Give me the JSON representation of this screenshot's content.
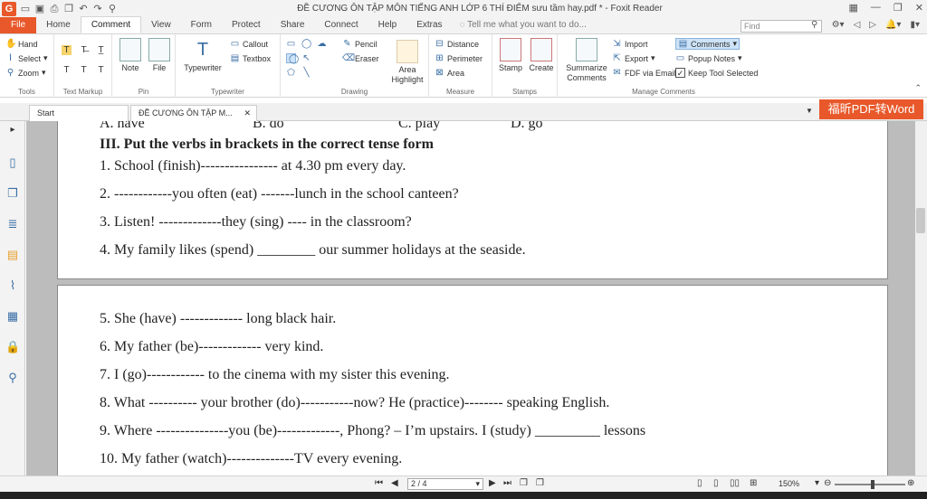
{
  "app": {
    "title": "ĐỀ CƯƠNG ÔN TẬP MÔN TIẾNG ANH LỚP 6 THÍ ĐIỂM sưu tầm hay.pdf * - Foxit Reader",
    "brand_color": "#e8582a"
  },
  "menu_tabs": [
    "File",
    "Home",
    "Comment",
    "View",
    "Form",
    "Protect",
    "Share",
    "Connect",
    "Help",
    "Extras"
  ],
  "tell_me": "Tell me what you want to do...",
  "find_placeholder": "Find",
  "ribbon": {
    "tools": {
      "items": [
        "Hand",
        "Select",
        "Zoom"
      ],
      "label": "Tools"
    },
    "text_markup": {
      "label": "Text Markup"
    },
    "pin": {
      "note": "Note",
      "file": "File",
      "label": "Pin"
    },
    "typewriter": {
      "typewriter": "Typewriter",
      "callout": "Callout",
      "textbox": "Textbox",
      "label": "Typewriter"
    },
    "drawing": {
      "pencil": "Pencil",
      "eraser": "Eraser",
      "area_highlight": "Area Highlight",
      "label": "Drawing"
    },
    "measure": {
      "distance": "Distance",
      "perimeter": "Perimeter",
      "area": "Area",
      "label": "Measure"
    },
    "stamps": {
      "stamp": "Stamp",
      "create": "Create",
      "label": "Stamps"
    },
    "manage": {
      "summarize": "Summarize Comments",
      "import": "Import",
      "export": "Export",
      "fdf": "FDF via Email",
      "comments": "Comments",
      "popup": "Popup Notes",
      "keep": "Keep Tool Selected",
      "label": "Manage Comments"
    }
  },
  "doc_tabs": [
    "Start",
    "ĐỀ CƯƠNG ÔN TẬP M..."
  ],
  "brand_banner": "福昕PDF转Word",
  "page1": {
    "options": {
      "a": "A. have",
      "b": "B. do",
      "c": "C. play",
      "d": "D. go"
    },
    "heading": "III. Put the verbs in brackets in the correct tense form",
    "lines": [
      "1. School (finish)---------------- at 4.30 pm every day.",
      "2. ------------you often (eat) -------lunch in the school canteen?",
      "3. Listen! -------------they (sing) ---- in the classroom?",
      "4. My family likes (spend) ________ our summer holidays at the seaside."
    ]
  },
  "page2": {
    "lines": [
      "5. She (have) ------------- long black hair.",
      "6. My father (be)------------- very kind.",
      "7. I (go)------------ to the cinema with my sister this evening.",
      "8. What ---------- your brother (do)-----------now? He (practice)-------- speaking English.",
      "9. Where ---------------you (be)-------------, Phong? – I’m upstairs. I (study) _________ lessons",
      "10. My father (watch)--------------TV every evening."
    ]
  },
  "status": {
    "page": "2 / 4",
    "zoom": "150%"
  }
}
